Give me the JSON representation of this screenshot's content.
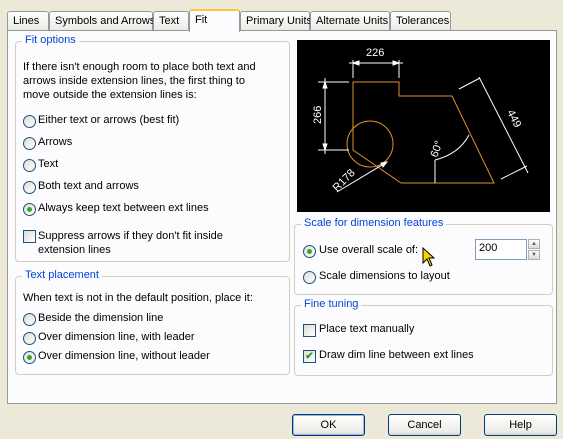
{
  "tabs": [
    "Lines",
    "Symbols and Arrows",
    "Text",
    "Fit",
    "Primary Units",
    "Alternate Units",
    "Tolerances"
  ],
  "active_tab": "Fit",
  "fit_options": {
    "legend": "Fit options",
    "description_lines": [
      "If there isn't enough room to place both text and",
      "arrows inside extension lines, the first thing to",
      "move outside the extension lines is:"
    ],
    "options": [
      "Either text or arrows (best fit)",
      "Arrows",
      "Text",
      "Both text and arrows",
      "Always keep text between ext lines"
    ],
    "selected": "Always keep text between ext lines",
    "suppress_lines": [
      "Suppress arrows if they don't fit inside",
      "extension lines"
    ],
    "suppress_checked": false
  },
  "text_placement": {
    "legend": "Text placement",
    "description": "When text is not in the default position, place it:",
    "options": [
      "Beside the dimension line",
      "Over dimension line, with leader",
      "Over dimension line, without leader"
    ],
    "selected": "Over dimension line, without leader"
  },
  "preview": {
    "dim_top": "226",
    "dim_left": "266",
    "dim_diag": "449",
    "dim_angle": "60°",
    "dim_radius": "R178",
    "colors": {
      "background": "#000000",
      "geometry": "#e0902a",
      "dimensions": "#ffffff"
    }
  },
  "scale": {
    "legend": "Scale for dimension features",
    "overall_label": "Use overall scale of:",
    "layout_label": "Scale dimensions to layout",
    "selected": "Use overall scale of:",
    "value": "200"
  },
  "fine_tuning": {
    "legend": "Fine tuning",
    "manual_label": "Place text manually",
    "manual_checked": false,
    "dimline_label": "Draw dim line between ext lines",
    "dimline_checked": true
  },
  "buttons": {
    "ok": "OK",
    "cancel": "Cancel",
    "help": "Help"
  },
  "colors": {
    "dialog_bg": "#ece9d8",
    "accent_legend": "#0046d5",
    "radio_dot": "#3ea230"
  }
}
